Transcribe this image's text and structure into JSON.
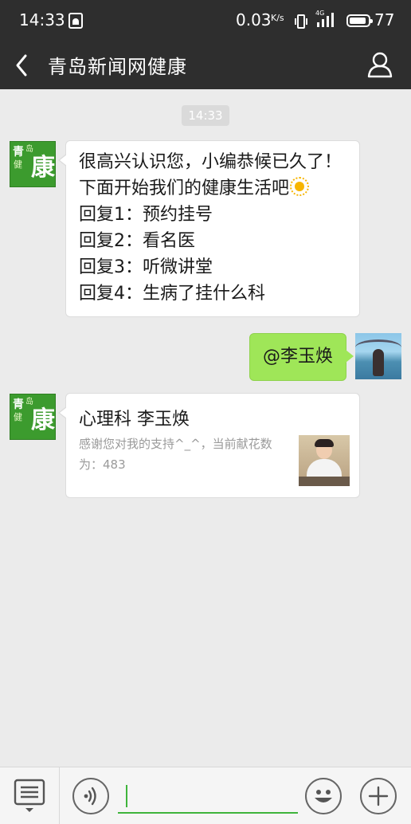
{
  "status_bar": {
    "time": "14:33",
    "net_speed": "0.03",
    "net_speed_unit": "K/s",
    "network_type": "4G",
    "battery": "77"
  },
  "title_bar": {
    "title": "青岛新闻网健康"
  },
  "chat": {
    "timestamp": "14:33",
    "messages": [
      {
        "sender": "bot",
        "avatar": {
          "line1": "青",
          "line2": "岛",
          "line3": "健",
          "big": "康"
        },
        "lines": [
          "很高兴认识您，小编恭候已久了！",
          "下面开始我们的健康生活吧",
          "回复1：预约挂号",
          "回复2：看名医",
          "回复3：听微讲堂",
          "回复4：生病了挂什么科"
        ],
        "emoji_icon": "sun-emoji"
      },
      {
        "sender": "user",
        "text": "@李玉焕"
      },
      {
        "sender": "bot",
        "avatar": {
          "line1": "青",
          "line2": "岛",
          "line3": "健",
          "big": "康"
        },
        "card": {
          "title": "心理科  李玉焕",
          "description": "感谢您对我的支持^_^，当前献花数为：483"
        }
      }
    ]
  },
  "input_bar": {
    "placeholder": "",
    "value": ""
  },
  "colors": {
    "header_bg": "#2e2e2e",
    "chat_bg": "#ebebeb",
    "user_bubble": "#9fe658",
    "brand_green": "#3c9b2e",
    "input_underline": "#3fb43c"
  }
}
